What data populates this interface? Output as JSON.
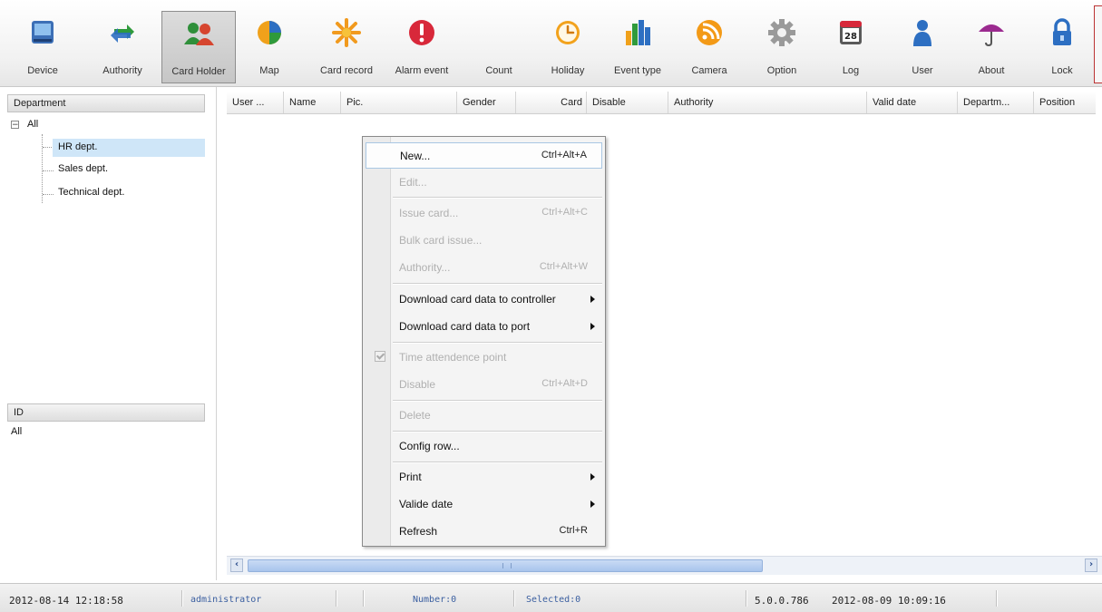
{
  "toolbar": {
    "items": [
      {
        "label": "Device",
        "icon": "device-icon"
      },
      {
        "label": "Authority",
        "icon": "authority-icon"
      },
      {
        "label": "Card Holder",
        "icon": "card-holder-icon"
      },
      {
        "label": "Map",
        "icon": "map-icon"
      },
      {
        "label": "Card record",
        "icon": "card-record-icon"
      },
      {
        "label": "Alarm event",
        "icon": "alarm-event-icon"
      },
      {
        "label": "Count",
        "icon": ""
      },
      {
        "label": "Holiday",
        "icon": "holiday-icon"
      },
      {
        "label": "Event type",
        "icon": "event-type-icon"
      },
      {
        "label": "Camera",
        "icon": "camera-icon"
      },
      {
        "label": "Option",
        "icon": "option-icon"
      },
      {
        "label": "Log",
        "icon": "log-icon"
      },
      {
        "label": "User",
        "icon": "user-icon"
      },
      {
        "label": "About",
        "icon": "about-icon"
      },
      {
        "label": "Lock",
        "icon": "lock-icon"
      }
    ],
    "log_day": "28",
    "active": "Card Holder"
  },
  "department_panel": {
    "header": "Department",
    "root": "All",
    "children": [
      "HR dept.",
      "Sales dept.",
      "Technical dept."
    ],
    "selected": "HR dept."
  },
  "id_panel": {
    "header": "ID",
    "value": "All"
  },
  "grid": {
    "columns": [
      "User ...",
      "Name",
      "Pic.",
      "Gender",
      "Card",
      "Disable",
      "Authority",
      "Valid date",
      "Departm...",
      "Position"
    ]
  },
  "context_menu": {
    "items": [
      {
        "label": "New...",
        "shortcut": "Ctrl+Alt+A",
        "enabled": true,
        "highlighted": true
      },
      {
        "label": "Edit...",
        "shortcut": "",
        "enabled": false
      },
      {
        "label": "Issue card...",
        "shortcut": "Ctrl+Alt+C",
        "enabled": false
      },
      {
        "label": "Bulk card issue...",
        "shortcut": "",
        "enabled": false
      },
      {
        "label": "Authority...",
        "shortcut": "Ctrl+Alt+W",
        "enabled": false
      },
      {
        "label": "Download card data to controller",
        "shortcut": "",
        "enabled": true,
        "submenu": true
      },
      {
        "label": "Download card data to port",
        "shortcut": "",
        "enabled": true,
        "submenu": true
      },
      {
        "label": "Time attendence point",
        "shortcut": "",
        "enabled": false,
        "checked": true
      },
      {
        "label": "Disable",
        "shortcut": "Ctrl+Alt+D",
        "enabled": false
      },
      {
        "label": "Delete",
        "shortcut": "",
        "enabled": false
      },
      {
        "label": "Config row...",
        "shortcut": "",
        "enabled": true
      },
      {
        "label": "Print",
        "shortcut": "",
        "enabled": true,
        "submenu": true
      },
      {
        "label": "Valide date",
        "shortcut": "",
        "enabled": true,
        "submenu": true
      },
      {
        "label": "Refresh",
        "shortcut": "Ctrl+R",
        "enabled": true
      }
    ]
  },
  "status_bar": {
    "datetime": "2012-08-14 12:18:58",
    "user": "administrator",
    "number": "Number:0",
    "selected": "Selected:0",
    "version": "5.0.0.786",
    "build_date": "2012-08-09 10:09:16"
  },
  "colors": {
    "selection": "#cfe6f8",
    "scroll_thumb": "#a8c4ec",
    "status_blue": "#3b5fa0"
  }
}
